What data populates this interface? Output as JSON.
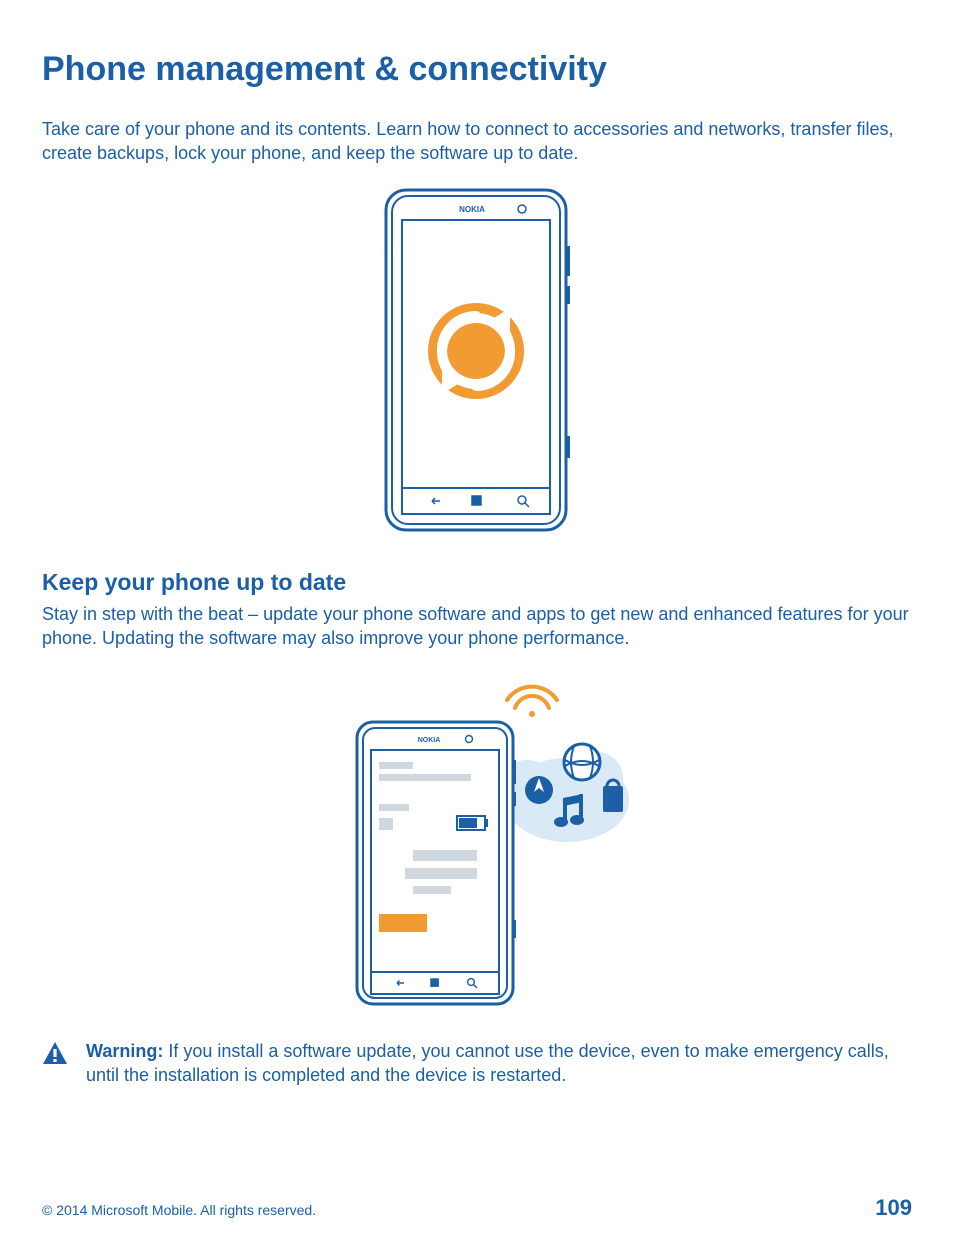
{
  "heading": "Phone management & connectivity",
  "intro": "Take care of your phone and its contents. Learn how to connect to accessories and networks, transfer files, create backups, lock your phone, and keep the software up to date.",
  "section1": {
    "title": "Keep your phone up to date",
    "intro": "Stay in step with the beat – update your phone software and apps to get new and enhanced features for your phone. Updating the software may also improve your phone performance."
  },
  "warning": {
    "label": "Warning:",
    "body": " If you install a software update, you cannot use the device, even to make emergency calls, until the installation is completed and the device is restarted."
  },
  "footer": {
    "copyright": "© 2014 Microsoft Mobile. All rights reserved.",
    "page": "109"
  },
  "phone_brand": "NOKIA"
}
